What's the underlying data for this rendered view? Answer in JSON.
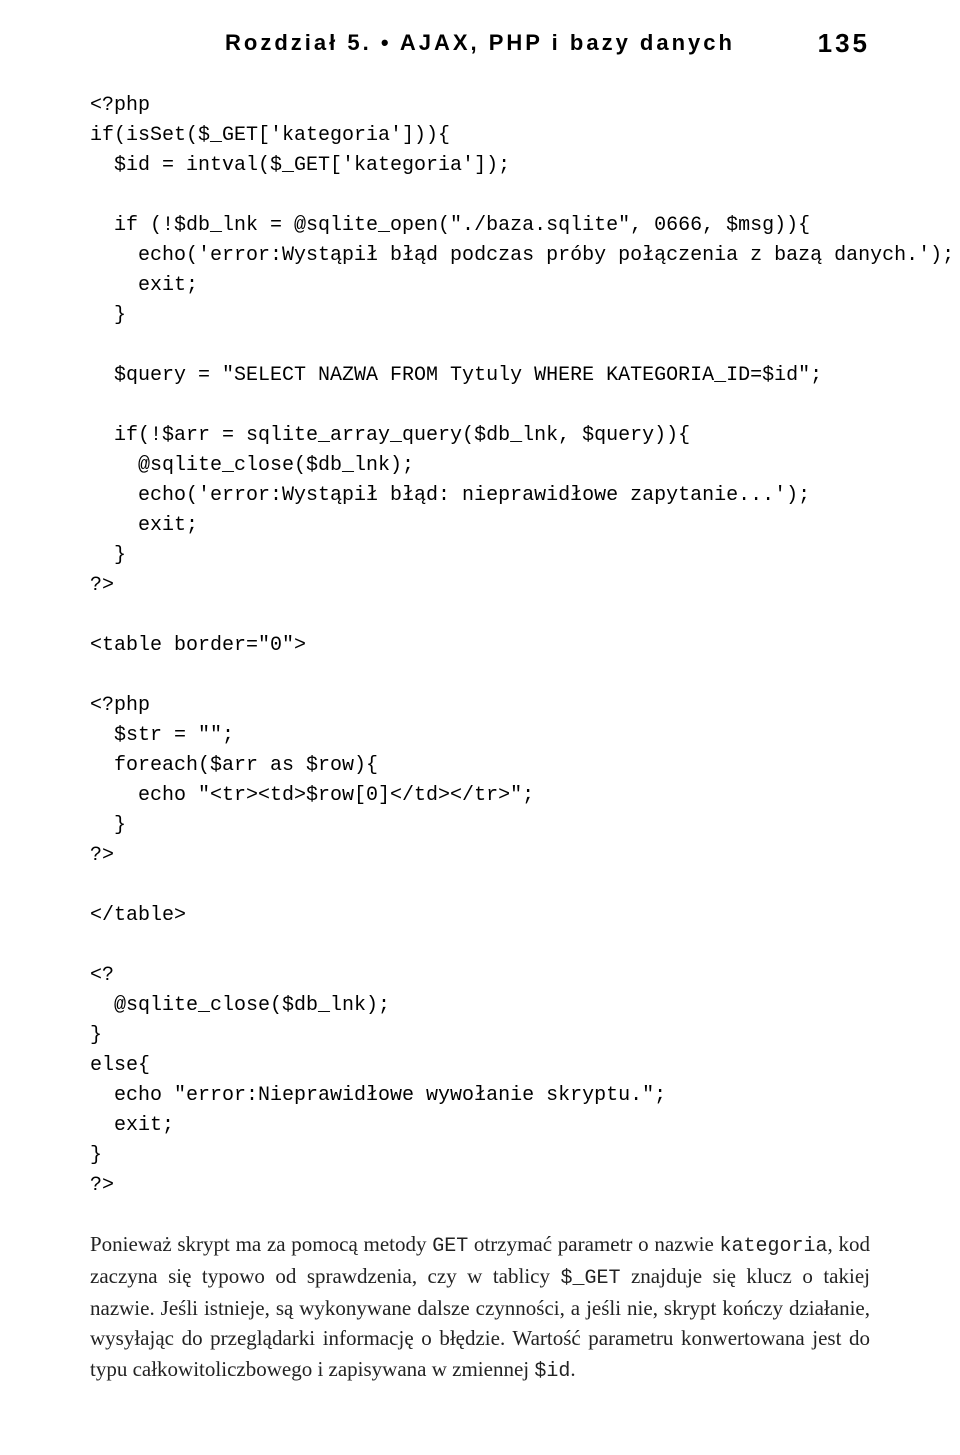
{
  "header": {
    "chapter": "Rozdział 5. • AJAX, PHP i bazy danych",
    "page_number": "135"
  },
  "code": "<?php\nif(isSet($_GET['kategoria'])){\n  $id = intval($_GET['kategoria']);\n\n  if (!$db_lnk = @sqlite_open(\"./baza.sqlite\", 0666, $msg)){\n    echo('error:Wystąpił błąd podczas próby połączenia z bazą danych.');\n    exit;\n  }\n\n  $query = \"SELECT NAZWA FROM Tytuly WHERE KATEGORIA_ID=$id\";\n\n  if(!$arr = sqlite_array_query($db_lnk, $query)){\n    @sqlite_close($db_lnk);\n    echo('error:Wystąpił błąd: nieprawidłowe zapytanie...');\n    exit;\n  }\n?>\n\n<table border=\"0\">\n\n<?php\n  $str = \"\";\n  foreach($arr as $row){\n    echo \"<tr><td>$row[0]</td></tr>\";\n  }\n?>\n\n</table>\n\n<?\n  @sqlite_close($db_lnk);\n}\nelse{\n  echo \"error:Nieprawidłowe wywołanie skryptu.\";\n  exit;\n}\n?>",
  "paragraph": {
    "t0": "Ponieważ skrypt ma za pomocą metody ",
    "c1": "GET",
    "t2": " otrzymać parametr o nazwie ",
    "c3": "kategoria",
    "t4": ", kod zaczyna się typowo od sprawdzenia, czy w tablicy ",
    "c5": "$_GET",
    "t6": " znajduje się klucz o takiej nazwie. Jeśli istnieje, są wykonywane dalsze czynności, a jeśli nie, skrypt kończy działanie, wysyłając do przeglądarki informację o błędzie. Wartość parametru konwertowana jest do typu całkowitoliczbowego i zapisywana w zmiennej ",
    "c7": "$id",
    "t8": "."
  }
}
